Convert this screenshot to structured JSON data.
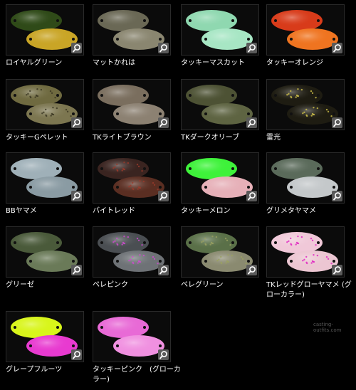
{
  "items": [
    {
      "label": "ロイヤルグリーン",
      "top": "#2f4a18",
      "bottom": "#c9a526",
      "speck": null
    },
    {
      "label": "マットかれは",
      "top": "#6a6855",
      "bottom": "#8a8670",
      "speck": null
    },
    {
      "label": "タッキーマスカット",
      "top": "#8fd8b0",
      "bottom": "#a7e6c4",
      "speck": null
    },
    {
      "label": "タッキーオレンジ",
      "top": "#d83b1a",
      "bottom": "#ef7420",
      "speck": null
    },
    {
      "label": "タッキーGペレット",
      "top": "#6f6a40",
      "bottom": "#7c7650",
      "speck": "#3a3620"
    },
    {
      "label": "TKライトブラウン",
      "top": "#7a6e5e",
      "bottom": "#8c8172",
      "speck": null
    },
    {
      "label": "TKダークオリーブ",
      "top": "#4d5234",
      "bottom": "#5e6442",
      "speck": null
    },
    {
      "label": "雷光",
      "top": "#1e1c12",
      "bottom": "#1e1c12",
      "speck": "#cfc24a"
    },
    {
      "label": "BBヤマメ",
      "top": "#9fb0b8",
      "bottom": "#8a9ba3",
      "speck": null
    },
    {
      "label": "バイトレッド",
      "top": "#3a2420",
      "bottom": "#5a2e22",
      "speck": "#9a3a2a"
    },
    {
      "label": "タッキーメロン",
      "top": "#3ef23a",
      "bottom": "#e6b0b8",
      "speck": null
    },
    {
      "label": "グリメタヤマメ",
      "top": "#5a6a5a",
      "bottom": "#c4c8ca",
      "speck": null
    },
    {
      "label": "グリーゼ",
      "top": "#4a5a3a",
      "bottom": "#6a7a58",
      "speck": null
    },
    {
      "label": "ペレピンク",
      "top": "#4a4e52",
      "bottom": "#6e7276",
      "speck": "#d04ad0"
    },
    {
      "label": "ペレグリーン",
      "top": "#5a7048",
      "bottom": "#8a8a70",
      "speck": "#9aa060"
    },
    {
      "label": "TKレッドグローヤマメ (グローカラー)",
      "top": "#f0c8d8",
      "bottom": "#ecc6d2",
      "speck": "#e020c0"
    },
    {
      "label": "グレープフルーツ",
      "top": "#d8f51a",
      "bottom": "#e83ad0",
      "speck": null
    },
    {
      "label": "タッキーピンク　(グローカラー)",
      "top": "#e86ad6",
      "bottom": "#f090e0",
      "speck": null
    }
  ],
  "watermark": "casting-outfits.com"
}
